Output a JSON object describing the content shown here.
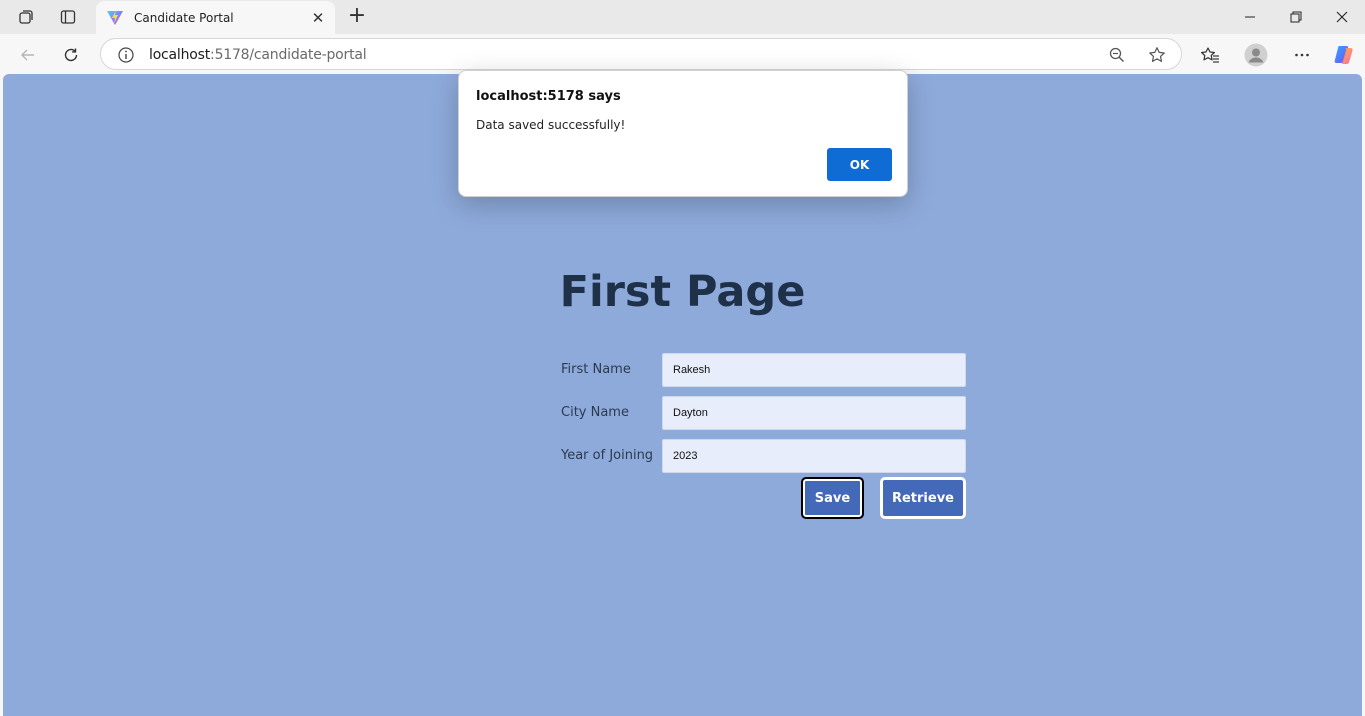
{
  "browser": {
    "tab": {
      "title": "Candidate Portal",
      "close_glyph": "✕"
    },
    "new_tab_glyph": "+",
    "url": {
      "host": "localhost",
      "path": ":5178/candidate-portal"
    },
    "window_controls": {
      "minimize": "—",
      "maximize": "❐",
      "close": "✕"
    },
    "icons": [
      "workspaces-icon",
      "tab-actions-icon",
      "back-icon",
      "refresh-icon",
      "site-info-icon",
      "zoom-icon",
      "favorite-star-icon",
      "favorites-icon",
      "profile-avatar-icon",
      "more-menu-icon",
      "copilot-icon"
    ]
  },
  "dialog": {
    "title": "localhost:5178 says",
    "message": "Data saved successfully!",
    "ok_label": "OK"
  },
  "page": {
    "title": "First Page",
    "background": "#8eaadb",
    "fields": [
      {
        "label": "First Name",
        "value": "Rakesh"
      },
      {
        "label": "City Name",
        "value": "Dayton"
      },
      {
        "label": "Year of Joining",
        "value": "2023"
      }
    ],
    "buttons": {
      "save": "Save",
      "retrieve": "Retrieve"
    }
  }
}
